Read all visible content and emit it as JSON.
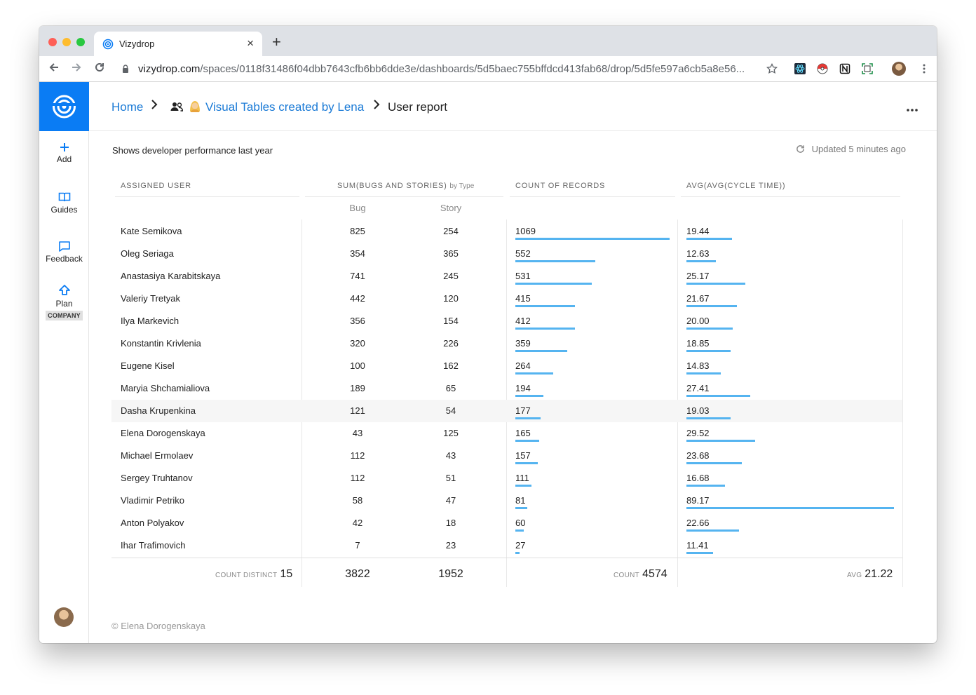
{
  "browser": {
    "tab_title": "Vizydrop",
    "url_host": "vizydrop.com",
    "url_path": "/spaces/0118f31486f04dbb7643cfb6bb6dde3e/dashboards/5d5baec755bffdcd413fab68/drop/5d5fe597a6cb5a8e56...",
    "close_glyph": "×",
    "newtab_glyph": "+"
  },
  "sidebar": {
    "items": [
      {
        "label": "Add",
        "icon": "plus-icon"
      },
      {
        "label": "Guides",
        "icon": "book-icon"
      },
      {
        "label": "Feedback",
        "icon": "chat-icon"
      },
      {
        "label": "Plan",
        "icon": "upload-arrow-icon",
        "badge": "COMPANY"
      }
    ]
  },
  "breadcrumb": {
    "home": "Home",
    "space": "Visual Tables created by Lena",
    "current": "User report"
  },
  "report": {
    "description": "Shows developer performance last year",
    "updated": "Updated 5 minutes ago"
  },
  "table": {
    "headers": {
      "user": "ASSIGNED USER",
      "sum": "SUM(BUGS AND STORIES)",
      "sum_suffix": "by Type",
      "count": "COUNT OF RECORDS",
      "avg": "AVG(AVG(CYCLE TIME))"
    },
    "subheaders": [
      "Bug",
      "Story"
    ],
    "rows": [
      {
        "user": "Kate Semikova",
        "bug": "825",
        "story": "254",
        "count": "1069",
        "avg": "19.44"
      },
      {
        "user": "Oleg Seriaga",
        "bug": "354",
        "story": "365",
        "count": "552",
        "avg": "12.63"
      },
      {
        "user": "Anastasiya Karabitskaya",
        "bug": "741",
        "story": "245",
        "count": "531",
        "avg": "25.17"
      },
      {
        "user": "Valeriy Tretyak",
        "bug": "442",
        "story": "120",
        "count": "415",
        "avg": "21.67"
      },
      {
        "user": "Ilya Markevich",
        "bug": "356",
        "story": "154",
        "count": "412",
        "avg": "20.00"
      },
      {
        "user": "Konstantin Krivlenia",
        "bug": "320",
        "story": "226",
        "count": "359",
        "avg": "18.85"
      },
      {
        "user": "Eugene Kisel",
        "bug": "100",
        "story": "162",
        "count": "264",
        "avg": "14.83"
      },
      {
        "user": "Maryia Shchamialiova",
        "bug": "189",
        "story": "65",
        "count": "194",
        "avg": "27.41"
      },
      {
        "user": "Dasha Krupenkina",
        "bug": "121",
        "story": "54",
        "count": "177",
        "avg": "19.03"
      },
      {
        "user": "Elena Dorogenskaya",
        "bug": "43",
        "story": "125",
        "count": "165",
        "avg": "29.52"
      },
      {
        "user": "Michael Ermolaev",
        "bug": "112",
        "story": "43",
        "count": "157",
        "avg": "23.68"
      },
      {
        "user": "Sergey Truhtanov",
        "bug": "112",
        "story": "51",
        "count": "111",
        "avg": "16.68"
      },
      {
        "user": "Vladimir Petriko",
        "bug": "58",
        "story": "47",
        "count": "81",
        "avg": "89.17"
      },
      {
        "user": "Anton Polyakov",
        "bug": "42",
        "story": "18",
        "count": "60",
        "avg": "22.66"
      },
      {
        "user": "Ihar Trafimovich",
        "bug": "7",
        "story": "23",
        "count": "27",
        "avg": "11.41"
      }
    ],
    "highlighted_row": 8,
    "footer": {
      "distinct_label": "COUNT DISTINCT",
      "distinct_value": "15",
      "bug_total": "3822",
      "story_total": "1952",
      "count_label": "COUNT",
      "count_value": "4574",
      "avg_label": "AVG",
      "avg_value": "21.22"
    },
    "bar_color": "#55b4f0"
  },
  "footer": {
    "copyright": "© Elena Dorogenskaya"
  },
  "colors": {
    "brand": "#0a7cf4",
    "link": "#1a7ad6"
  }
}
